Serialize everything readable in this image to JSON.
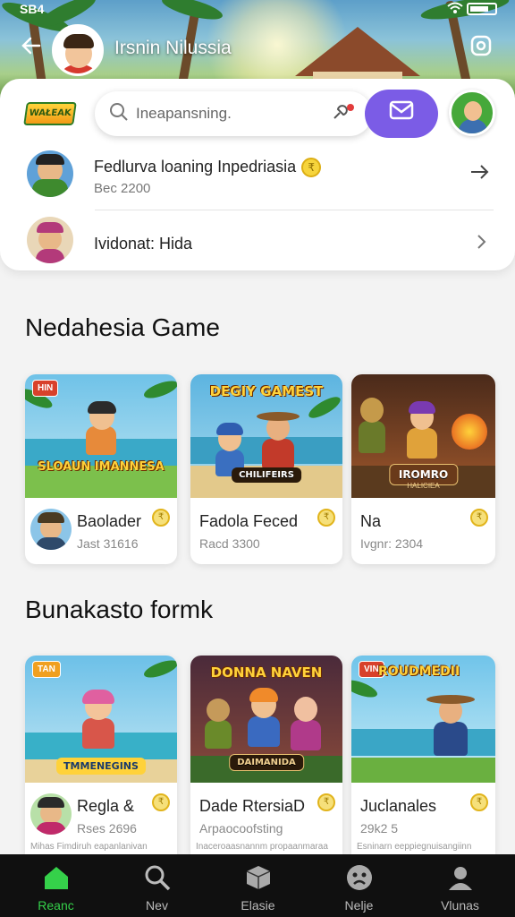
{
  "status_bar": {
    "time": "SB4"
  },
  "header": {
    "title": "Irsnin Nilussia"
  },
  "logo_text": "WAŁEAK",
  "search": {
    "placeholder": "Ineapansning."
  },
  "notifications": [
    {
      "title": "Fedlurva loaning Inpedriasia",
      "subtitle": "Bec 2200",
      "coin": "₹"
    },
    {
      "title": "Ividonat: Hida"
    }
  ],
  "sections": [
    {
      "title": "Nedahesia Game",
      "cards": [
        {
          "thumb_title": "SLOAUN IMANNESA",
          "badge": "HIN",
          "name": "Baolader",
          "sub": "Jast 31616"
        },
        {
          "thumb_title": "DEGIY GAMEST",
          "banner": "CHILIFEIRS",
          "name": "Fadola Feced",
          "sub": "Racd 3300"
        },
        {
          "thumb_title": "IROMRO",
          "banner": "HALICIEA",
          "name": "Na",
          "sub": "Ivgnr: 2304"
        }
      ]
    },
    {
      "title": "Bunakasto formk",
      "cards": [
        {
          "thumb_title": "TMMENEGINS",
          "badge": "TAN",
          "name": "Regla &",
          "sub": "Rses 2696",
          "small": "Mihas  Fimdiruh eapanlanivan"
        },
        {
          "thumb_title": "DONNA NAVEN",
          "banner": "DAIMANIDA",
          "name": "Dade RtersiaD",
          "sub": "Arpaocoofsting",
          "small": "Inaceroaasnannm propaanmaraa"
        },
        {
          "thumb_title": "ROUDMEDII",
          "badge": "VIN",
          "name": "Juclanales",
          "sub": "29k2 5",
          "small": "Esninarn eeppiegnuisangiinn"
        }
      ]
    }
  ],
  "nav": [
    {
      "label": "Reanc",
      "icon": "home-icon",
      "active": true
    },
    {
      "label": "Nev",
      "icon": "search-icon"
    },
    {
      "label": "Elasie",
      "icon": "box-icon"
    },
    {
      "label": "Nelje",
      "icon": "sad-face-icon"
    },
    {
      "label": "Vlunas",
      "icon": "person-icon"
    }
  ]
}
